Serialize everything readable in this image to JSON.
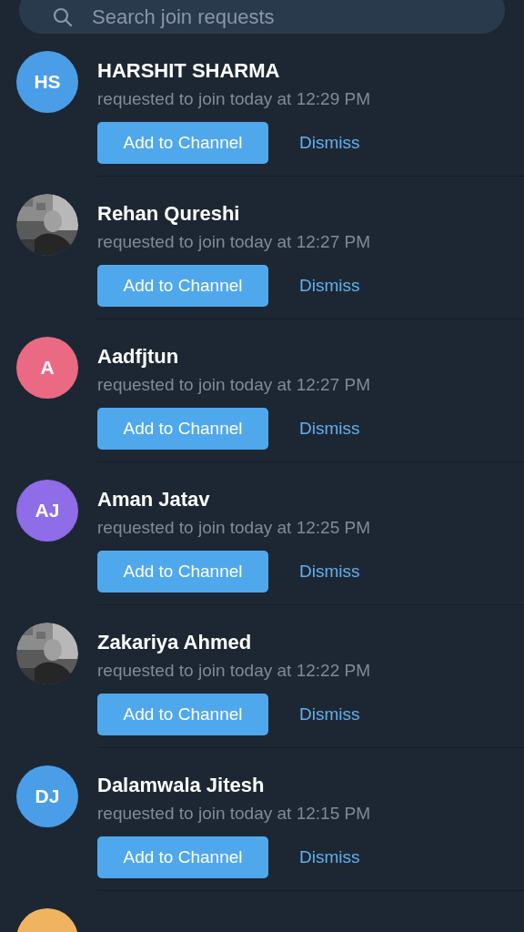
{
  "search": {
    "placeholder": "Search join requests"
  },
  "requests": [
    {
      "name": "HARSHIT SHARMA",
      "subtitle": "requested to join today at 12:29 PM",
      "avatar": {
        "kind": "initials",
        "text": "HS",
        "color": "#4a9ee8"
      },
      "add_label": "Add to Channel",
      "dismiss_label": "Dismiss"
    },
    {
      "name": "Rehan Qureshi",
      "subtitle": "requested to join today at 12:27 PM",
      "add_label": "Add to Channel",
      "dismiss_label": "Dismiss"
    },
    {
      "name": "Aadfjtun",
      "subtitle": "requested to join today at 12:27 PM",
      "avatar": {
        "kind": "initials",
        "text": "A",
        "color": "#ea6a84"
      },
      "add_label": "Add to Channel",
      "dismiss_label": "Dismiss"
    },
    {
      "name": "Aman Jatav",
      "subtitle": "requested to join today at 12:25 PM",
      "avatar": {
        "kind": "initials",
        "text": "AJ",
        "color": "#8f6ce8"
      },
      "add_label": "Add to Channel",
      "dismiss_label": "Dismiss"
    },
    {
      "name": "Zakariya Ahmed",
      "subtitle": "requested to join today at 12:22 PM",
      "add_label": "Add to Channel",
      "dismiss_label": "Dismiss"
    },
    {
      "name": "Dalamwala Jitesh",
      "subtitle": "requested to join today at 12:15 PM",
      "avatar": {
        "kind": "initials",
        "text": "DJ",
        "color": "#4a9ee8"
      },
      "add_label": "Add to Channel",
      "dismiss_label": "Dismiss"
    },
    {
      "avatar": {
        "kind": "initials",
        "color": "#f0b460"
      }
    }
  ]
}
